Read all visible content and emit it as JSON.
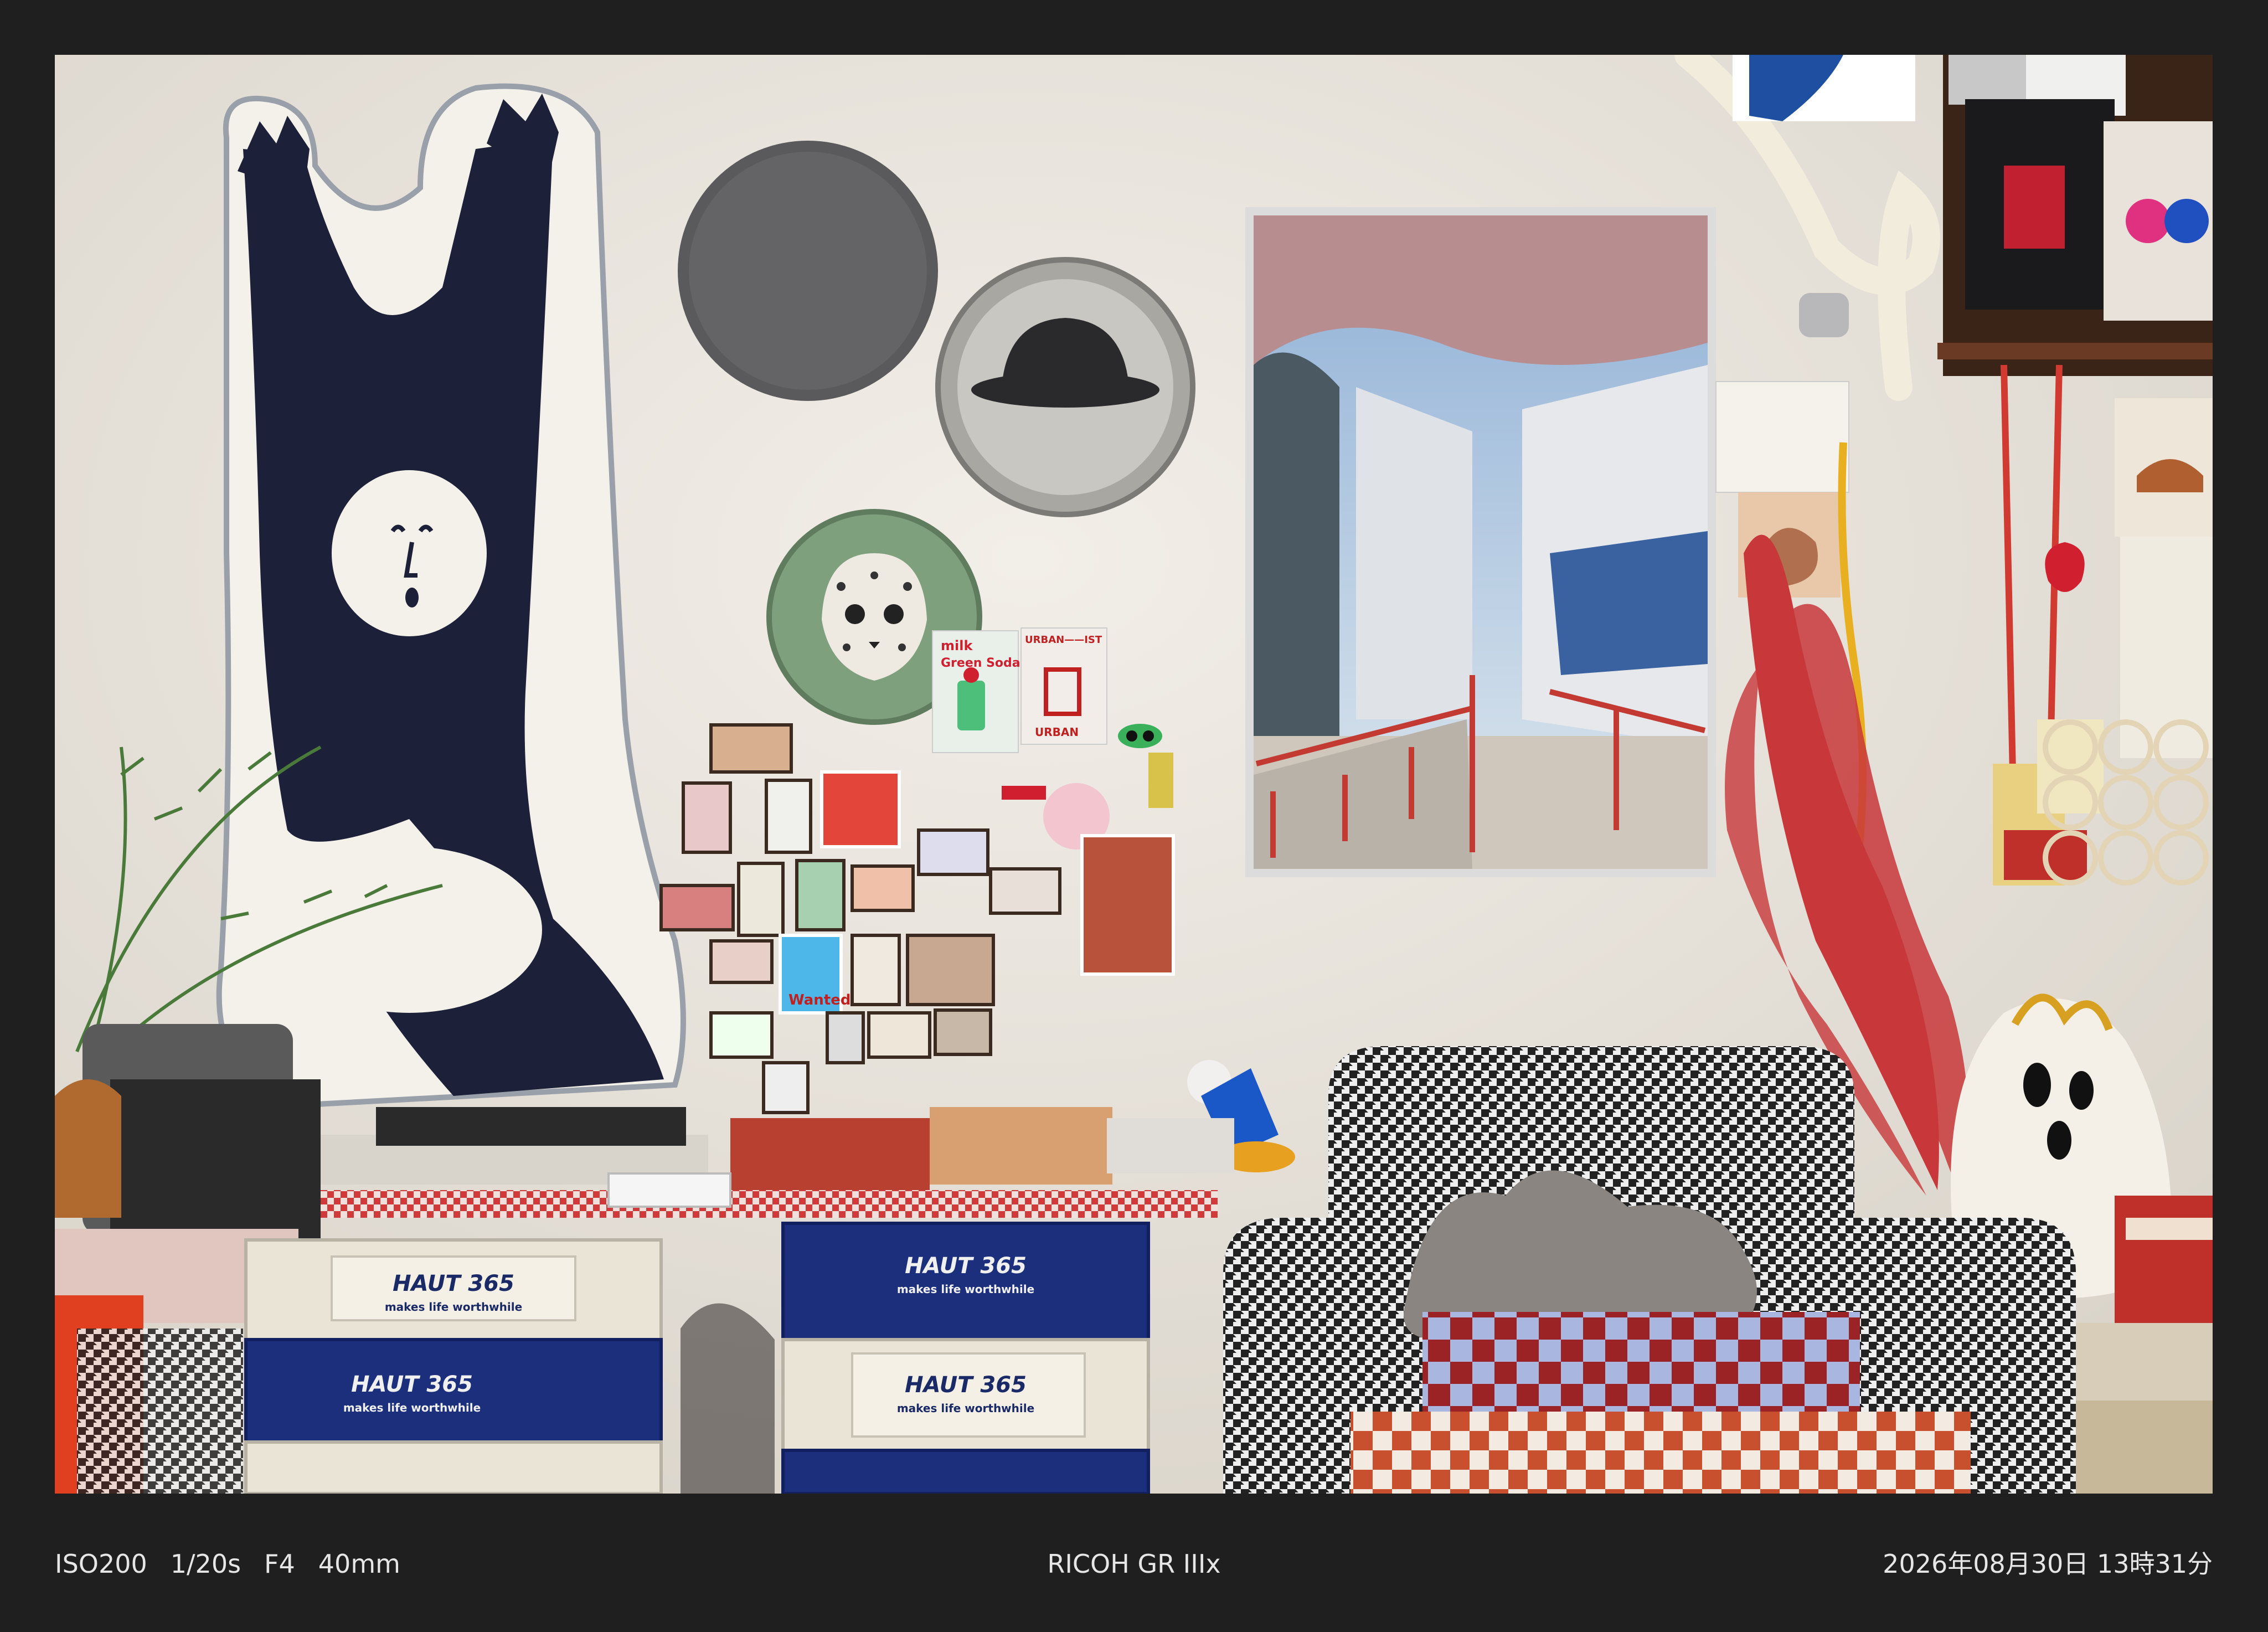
{
  "exif": {
    "iso": "ISO200",
    "shutter": "1/20s",
    "aperture": "F4",
    "focal_length": "40mm",
    "camera": "RICOH GR IIIx",
    "datetime": "2026年08月30日 13時31分"
  },
  "photo_text": {
    "crate_brand": "HAUT 365",
    "crate_slogan": "makes life worthwhile",
    "sticker_milk": "milk",
    "sticker_green_soda": "Green Soda",
    "sticker_urban": "URBAN",
    "sticker_wanted": "Wanted",
    "sticker_urbanist": "URBAN——IST"
  },
  "colors": {
    "border": "#1f1f1f",
    "caption_text": "#e6e6e6",
    "wall": "#ece7e0",
    "crate_blue": "#1b2f7c",
    "crate_cream": "#e9e4d6",
    "pampas_red": "#c8373a"
  }
}
